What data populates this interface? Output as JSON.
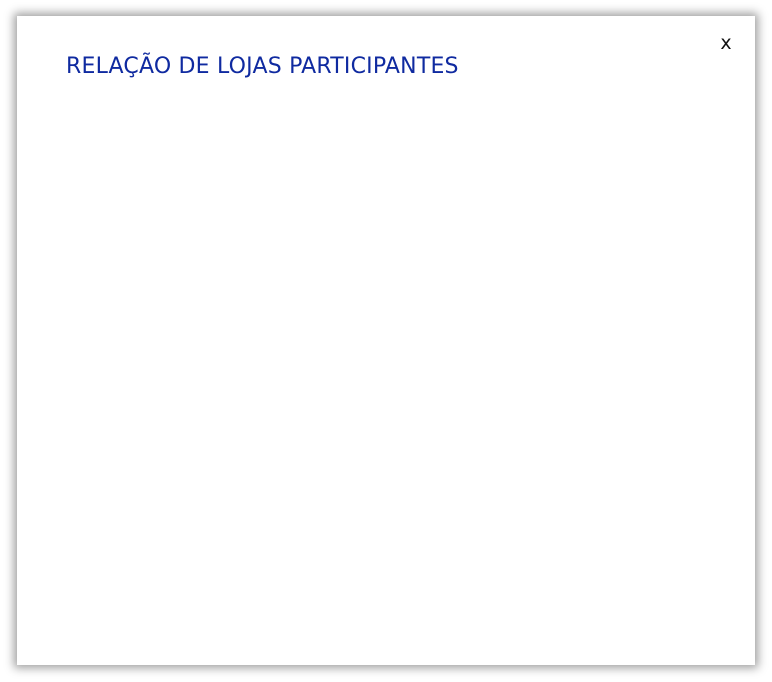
{
  "modal": {
    "title": "RELAÇÃO DE LOJAS PARTICIPANTES",
    "close_label": "x",
    "stores": []
  },
  "colors": {
    "title": "#0f2aa0",
    "background": "#ffffff"
  }
}
